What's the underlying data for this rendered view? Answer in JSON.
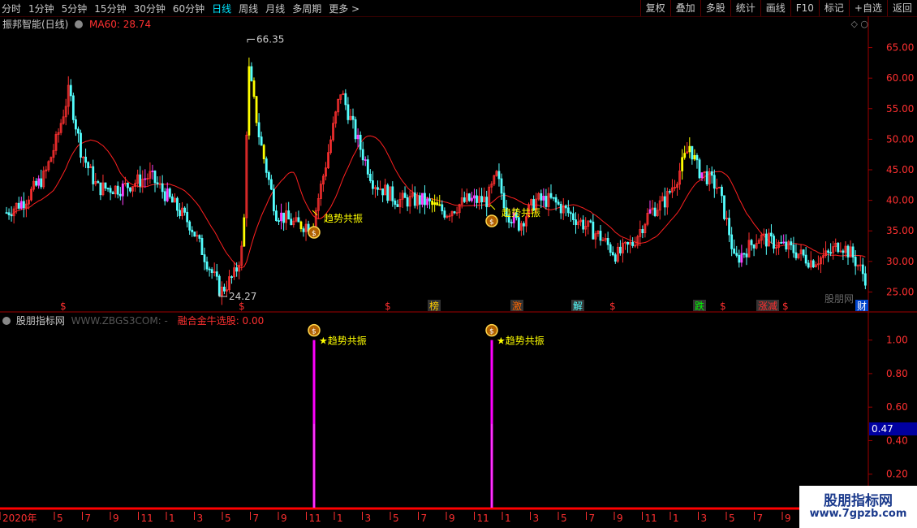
{
  "toolbar": {
    "periods": [
      "分时",
      "1分钟",
      "5分钟",
      "15分钟",
      "30分钟",
      "60分钟",
      "日线",
      "周线",
      "月线",
      "多周期",
      "更多 >"
    ],
    "active_period": "日线",
    "actions": [
      "复权",
      "叠加",
      "多股",
      "统计",
      "画线",
      "F10",
      "标记",
      "+自选",
      "返回"
    ]
  },
  "price_panel": {
    "stock_name": "振邦智能(日线)",
    "ma_label": "MA60: 28.74",
    "high_label": "66.35",
    "low_label": "24.27",
    "y_ticks": [
      "65.00",
      "60.00",
      "55.00",
      "50.00",
      "45.00",
      "40.00",
      "35.00",
      "30.00",
      "25.00"
    ],
    "signal_text": "趋势共振",
    "event_badges": [
      "$",
      "$",
      "$",
      "榜",
      "激",
      "解",
      "$",
      "跌",
      "$",
      "涨减",
      "$",
      "财"
    ],
    "watermark": "股朋网"
  },
  "indicator_panel": {
    "name": "股朋指标网",
    "watermark": "WWW.ZBGS3COM: -",
    "value_label": "融合金牛选股: 0.00",
    "y_ticks": [
      "1.00",
      "0.80",
      "0.60",
      "0.40",
      "0.20"
    ],
    "current_value": "0.47",
    "signal_text": "★趋势共振"
  },
  "x_axis": {
    "labels": [
      "2020年",
      "5",
      "7",
      "9",
      "11",
      "1",
      "3",
      "5",
      "7",
      "9",
      "11",
      "1",
      "3",
      "5",
      "7",
      "9",
      "11",
      "1",
      "3",
      "5",
      "7",
      "9",
      "11",
      "1",
      "3",
      "5",
      "7",
      "9",
      "11"
    ]
  },
  "chart_data": {
    "type": "candlestick",
    "price_ylim": [
      22,
      68
    ],
    "high": 66.35,
    "low": 24.27,
    "ma60_last": 28.74,
    "indicator_ylim": [
      0,
      1.1
    ],
    "indicator_spikes": [
      1.0,
      1.0
    ],
    "current_indicator": 0.47
  },
  "brand": {
    "name": "股朋指标网",
    "url": "www.7gpzb.com"
  },
  "colors": {
    "up": "#ff3030",
    "down": "#54ffff",
    "ma": "#ff2020",
    "signal": "#ffff00",
    "spike": "#ff00ff",
    "axis": "#a00000"
  }
}
